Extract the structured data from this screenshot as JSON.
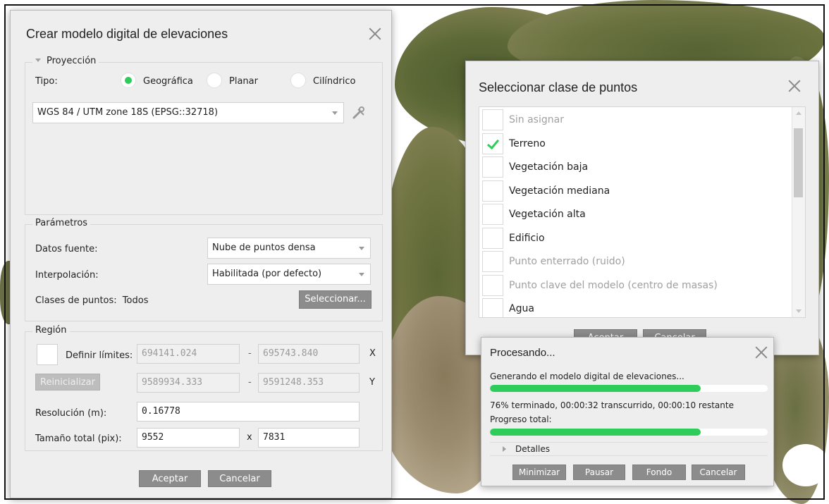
{
  "dem_dialog": {
    "title": "Crear modelo digital de elevaciones",
    "projection": {
      "legend": "Proyección",
      "type_label": "Tipo:",
      "options": [
        "Geográfica",
        "Planar",
        "Cilíndrico"
      ],
      "selected": "Geográfica",
      "crs_value": "WGS 84 / UTM zone 18S (EPSG::32718)"
    },
    "parameters": {
      "legend": "Parámetros",
      "source_label": "Datos fuente:",
      "source_value": "Nube de puntos densa",
      "interp_label": "Interpolación:",
      "interp_value": "Habilitada (por defecto)",
      "classes_label": "Clases de puntos:",
      "classes_value": "Todos",
      "select_button": "Seleccionar..."
    },
    "region": {
      "legend": "Región",
      "define_label": "Definir límites:",
      "reset_button": "Reinicializar",
      "x_min": "694141.024",
      "x_max": "695743.840",
      "x_label": "X",
      "y_min": "9589934.333",
      "y_max": "9591248.353",
      "y_label": "Y",
      "dash": "-",
      "resolution_label": "Resolución (m):",
      "resolution_value": "0.16778",
      "size_label": "Tamaño total (pix):",
      "size_w": "9552",
      "size_sep": "x",
      "size_h": "7831"
    },
    "ok_button": "Aceptar",
    "cancel_button": "Cancelar"
  },
  "class_dialog": {
    "title": "Seleccionar clase de puntos",
    "items": [
      {
        "label": "Sin asignar",
        "checked": false,
        "dim": true
      },
      {
        "label": "Terreno",
        "checked": true,
        "dim": false
      },
      {
        "label": "Vegetación baja",
        "checked": false,
        "dim": false
      },
      {
        "label": "Vegetación mediana",
        "checked": false,
        "dim": false
      },
      {
        "label": "Vegetación alta",
        "checked": false,
        "dim": false
      },
      {
        "label": "Edificio",
        "checked": false,
        "dim": false
      },
      {
        "label": "Punto enterrado (ruido)",
        "checked": false,
        "dim": true
      },
      {
        "label": "Punto clave del modelo (centro de masas)",
        "checked": false,
        "dim": true
      },
      {
        "label": "Agua",
        "checked": false,
        "dim": false
      }
    ],
    "ok_button": "Aceptar",
    "cancel_button": "Cancelar"
  },
  "progress_dialog": {
    "title": "Procesando...",
    "task_text": "Generando el modelo digital de elevaciones...",
    "task_progress": 0.76,
    "status_text": "76% terminado, 00:00:32 transcurrido, 00:00:10 restante",
    "total_label": "Progreso total:",
    "total_progress": 0.76,
    "details_label": "Detalles",
    "buttons": [
      "Minimizar",
      "Pausar",
      "Fondo",
      "Cancelar"
    ]
  },
  "colors": {
    "accent_green": "#2ecc5a",
    "button_gray": "#8c8c8c",
    "dialog_bg": "#eeeeee"
  }
}
